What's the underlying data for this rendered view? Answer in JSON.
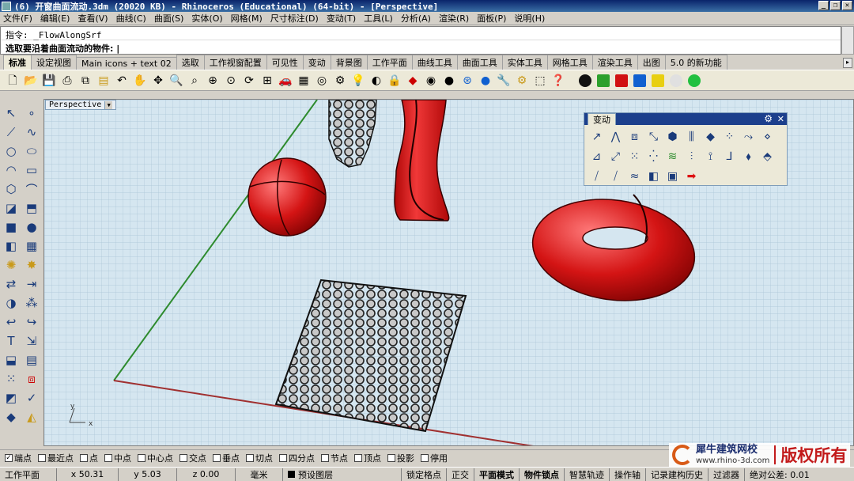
{
  "window": {
    "title": "(6) 开窗曲面流动.3dm (20020 KB) - Rhinoceros (Educational) (64-bit) - [Perspective]",
    "buttons": [
      "_",
      "❐",
      "✕"
    ]
  },
  "menu": [
    "文件(F)",
    "编辑(E)",
    "查看(V)",
    "曲线(C)",
    "曲面(S)",
    "实体(O)",
    "网格(M)",
    "尺寸标注(D)",
    "变动(T)",
    "工具(L)",
    "分析(A)",
    "渲染(R)",
    "面板(P)",
    "说明(H)"
  ],
  "command": {
    "history": "指令: _FlowAlongSrf",
    "prompt": "选取要沿着曲面流动的物件:"
  },
  "tabs": [
    "标准",
    "设定视图",
    "Main icons + text 02",
    "选取",
    "工作视窗配置",
    "可见性",
    "变动",
    "背景图",
    "工作平面",
    "曲线工具",
    "曲面工具",
    "实体工具",
    "网格工具",
    "渲染工具",
    "出图",
    "5.0 的新功能"
  ],
  "active_tab": "标准",
  "toolbar_icons": [
    "new-file-icon",
    "open-file-icon",
    "save-icon",
    "print-icon",
    "copy-icon",
    "paste-icon",
    "undo-icon",
    "pan-icon",
    "rotate-view-icon",
    "zoom-icon",
    "zoom-window-icon",
    "zoom-extents-icon",
    "zoom-selected-icon",
    "rotate-icon",
    "four-viewports-icon",
    "car-icon",
    "tile-icon",
    "cplane-icon",
    "options-icon",
    "light-icon",
    "hide-icon",
    "lock-icon",
    "layer-icon",
    "color-wheel-icon",
    "material-icon",
    "properties-icon",
    "help-icon",
    "wrench-icon",
    "gear-icon",
    "history-icon",
    "question-icon"
  ],
  "toolbar_balls": [
    "#111111",
    "#2ca02c",
    "#d11111",
    "#1060d0",
    "#e8cf10",
    "#e0e0e0",
    "#22c040"
  ],
  "viewport": {
    "label": "Perspective",
    "axis_x": "x",
    "axis_y": "y"
  },
  "transform_panel": {
    "title": "变动"
  },
  "osnaps": [
    {
      "label": "端点",
      "checked": true
    },
    {
      "label": "最近点",
      "checked": false
    },
    {
      "label": "点",
      "checked": false
    },
    {
      "label": "中点",
      "checked": false
    },
    {
      "label": "中心点",
      "checked": false
    },
    {
      "label": "交点",
      "checked": false
    },
    {
      "label": "垂点",
      "checked": false
    },
    {
      "label": "切点",
      "checked": false
    },
    {
      "label": "四分点",
      "checked": false
    },
    {
      "label": "节点",
      "checked": false
    },
    {
      "label": "顶点",
      "checked": false
    },
    {
      "label": "投影",
      "checked": false
    },
    {
      "label": "停用",
      "checked": false
    }
  ],
  "status": {
    "cplane": "工作平面",
    "x": "x 50.31",
    "y": "y 5.03",
    "z": "z 0.00",
    "unit": "毫米",
    "layer": "预设图层",
    "grid_snap": "锁定格点",
    "ortho": "正交",
    "planar": "平面模式",
    "osnap": "物件锁点",
    "smarttrack": "智慧轨迹",
    "gumball": "操作轴",
    "history": "记录建构历史",
    "filter": "过滤器",
    "tolerance": "绝对公差: 0.01"
  },
  "watermark": {
    "name": "犀牛建筑网校",
    "url": "www.rhino-3d.com",
    "copyright": "版权所有"
  }
}
